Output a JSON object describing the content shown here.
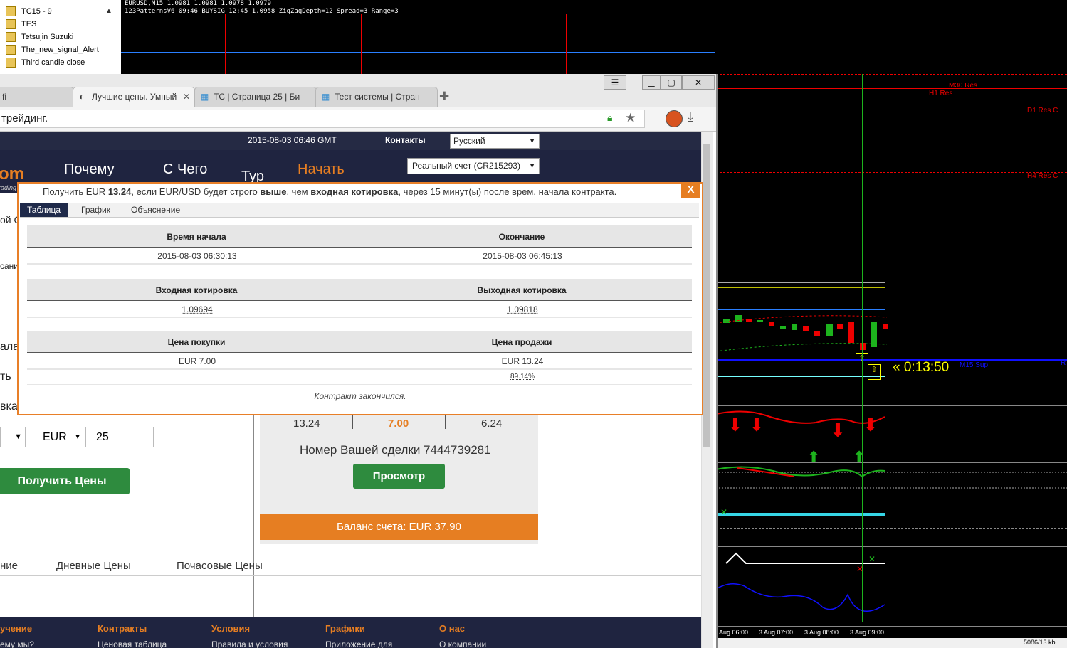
{
  "navigator": {
    "items": [
      "TC15 - 9",
      "TES",
      "Tetsujin Suzuki",
      "The_new_signal_Alert",
      "Third candle close"
    ]
  },
  "top_chart": {
    "symbol_line": "EURUSD,M15  1.0981 1.0981 1.0978 1.0979",
    "indicator_line": "123PatternsV6  09:46  BUYSIG  12:45  1.0958  ZigZagDepth=12  Spread=3  Range=3"
  },
  "browser": {
    "tabs": [
      {
        "label": "fi"
      },
      {
        "label": "Лучшие цены. Умный",
        "active": true
      },
      {
        "label": "TC | Страница 25 | Би"
      },
      {
        "label": "Тест системы | Стран"
      }
    ],
    "url_text": "трейдинг.",
    "winbtn_menu": "☰",
    "winbtn_min": "▁",
    "winbtn_max": "▢",
    "winbtn_close": "✕"
  },
  "site": {
    "datetime": "2015-08-03 06:46 GMT",
    "contacts": "Контакты",
    "language": "Русский",
    "account": "Реальный счет (CR215293)",
    "logo_partial": "om",
    "logo_sub": "rading",
    "nav": [
      "Почему",
      "С Чего",
      "Тур",
      "Начать"
    ],
    "left_partials": [
      "ой С",
      "сани",
      "ала",
      "ть",
      "вка"
    ],
    "currency": "EUR",
    "amount": "25",
    "get_prices": "Получить Цены",
    "payout_values": [
      "13.24",
      "7.00",
      "6.24"
    ],
    "deal_number": "Номер Вашей сделки 7444739281",
    "view_button": "Просмотр",
    "balance": "Баланс счета: EUR 37.90",
    "price_tabs": [
      "ние",
      "Дневные Цены",
      "Почасовые Цены"
    ],
    "footer": [
      "учение",
      "Контракты",
      "Условия",
      "Графики",
      "О нас"
    ],
    "footer_sub": [
      "ему мы?",
      "Ценовая таблица",
      "Правила и условия",
      "Приложение для",
      "О компании"
    ]
  },
  "dialog": {
    "message_pre": "Получить EUR ",
    "message_amount": "13.24",
    "message_mid": ", если EUR/USD будет строго ",
    "message_bold1": "выше",
    "message_mid2": ", чем ",
    "message_bold2": "входная котировка",
    "message_post": ", через 15 минут(ы) после врем. начала контракта.",
    "close": "X",
    "tabs": [
      "Таблица",
      "График",
      "Объяснение"
    ],
    "start_label": "Время начала",
    "end_label": "Окончание",
    "start_value": "2015-08-03 06:30:13",
    "end_value": "2015-08-03 06:45:13",
    "entry_label": "Входная котировка",
    "exit_label": "Выходная котировка",
    "entry_value": "1.09694",
    "exit_value": "1.09818",
    "buy_label": "Цена покупки",
    "sell_label": "Цена продажи",
    "buy_value": "EUR 7.00",
    "sell_value": "EUR 13.24",
    "return_pct": "89.14%",
    "status": "Контракт закончился."
  },
  "right_chart": {
    "labels": [
      "M30 Res",
      "H1 Res",
      "D1 Res C",
      "H4 Res C",
      "M15 Sup",
      "R"
    ],
    "timer": "« 0:13:50",
    "time_axis": [
      "Aug 06:00",
      "3 Aug 07:00",
      "3 Aug 08:00",
      "3 Aug 09:00"
    ],
    "status": "5086/13 kb"
  },
  "colors": {
    "orange": "#e67e22",
    "navy": "#1f2440",
    "green_button": "#2e8b3e",
    "chart_red": "#ff0000",
    "timer_yellow": "#ffff00"
  }
}
